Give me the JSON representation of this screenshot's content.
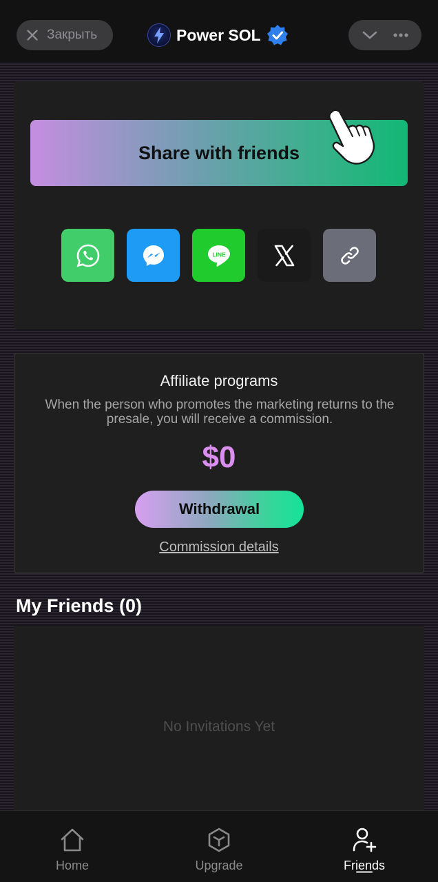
{
  "header": {
    "close_label": "Закрыть",
    "app_title": "Power SOL",
    "logo_text": "PowerSOL"
  },
  "share": {
    "button_label": "Share with friends",
    "socials": [
      "whatsapp-icon",
      "messenger-icon",
      "line-icon",
      "x-icon",
      "link-icon"
    ],
    "line_text": "LINE"
  },
  "affiliate": {
    "title": "Affiliate programs",
    "description": "When the person who promotes the marketing returns to the presale, you will receive a commission.",
    "amount": "$0",
    "withdraw_label": "Withdrawal",
    "details_link": "Commission details"
  },
  "friends": {
    "heading": "My Friends (0)",
    "empty_text": "No Invitations Yet"
  },
  "nav": {
    "items": [
      {
        "label": "Home",
        "icon": "home-icon"
      },
      {
        "label": "Upgrade",
        "icon": "upgrade-icon"
      },
      {
        "label": "Friends",
        "icon": "add-friend-icon",
        "active": true
      }
    ]
  },
  "colors": {
    "accent_purple": "#d98ef0",
    "accent_green": "#12b775",
    "verified_blue": "#2f80ed"
  }
}
